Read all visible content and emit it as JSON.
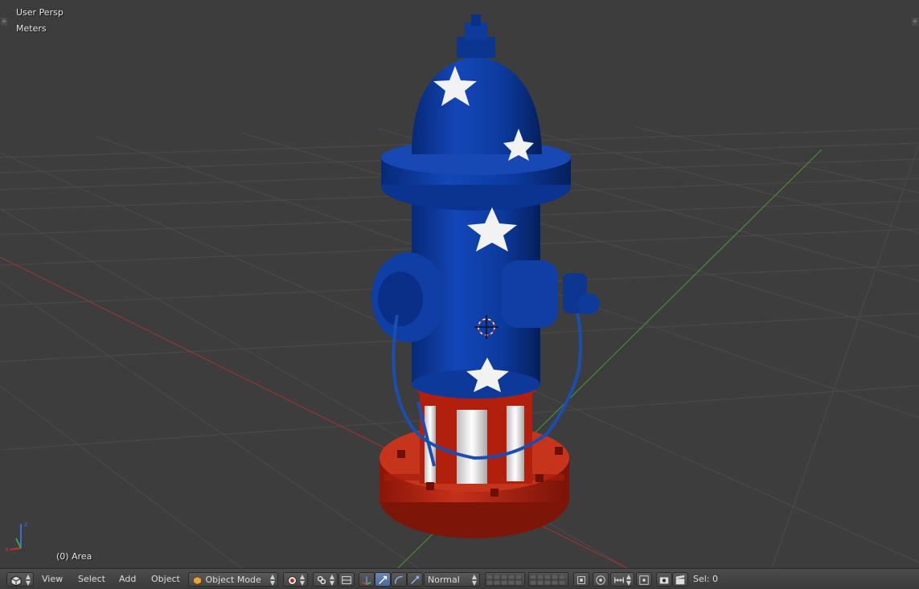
{
  "viewport": {
    "view_name": "User Persp",
    "units": "Meters",
    "object_info": "(0) Area"
  },
  "header": {
    "menus": [
      "View",
      "Select",
      "Add",
      "Object"
    ],
    "mode": "Object Mode",
    "shading": "Normal",
    "selection": "Sel: 0"
  },
  "icons": {
    "editor_type": "cube-editor-icon",
    "viewport_shading": "shading-icon",
    "pivot": "pivot-icon",
    "manipulator": "manipulator-icon",
    "translate": "translate-icon",
    "rotate": "rotate-icon",
    "scale": "scale-icon",
    "layers": "layers-icon",
    "snap": "snap-icon",
    "proportional": "proportional-edit-icon",
    "render": "render-icon",
    "clapper": "animation-icon"
  },
  "colors": {
    "hydrant_blue": "#0b3a9c",
    "hydrant_red": "#b8220f",
    "star_white": "#f2f2f2",
    "axis_x": "#a83232",
    "axis_y": "#4a9c2e",
    "active_button": "#5a7ab0"
  }
}
